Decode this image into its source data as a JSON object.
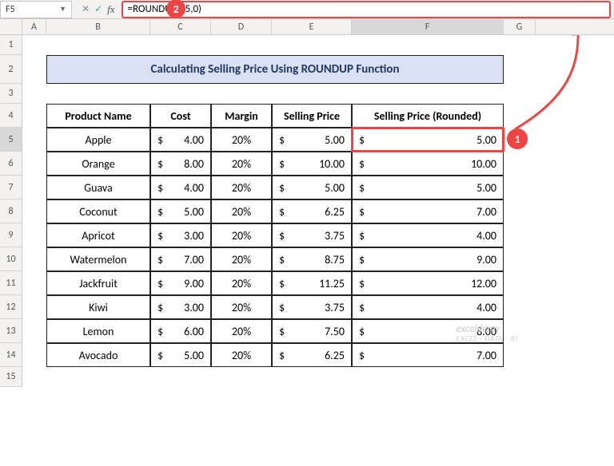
{
  "nameBox": "F5",
  "formula": "=ROUNDUP(E5,0)",
  "callout1": "1",
  "callout2": "2",
  "columns": [
    "A",
    "B",
    "C",
    "D",
    "E",
    "F",
    "G"
  ],
  "rows": [
    "1",
    "2",
    "3",
    "4",
    "5",
    "6",
    "7",
    "8",
    "9",
    "10",
    "11",
    "12",
    "13",
    "14",
    "15"
  ],
  "title": "Calculating Selling Price Using ROUNDUP Function",
  "headers": {
    "product": "Product Name",
    "cost": "Cost",
    "margin": "Margin",
    "selling": "Selling Price",
    "rounded": "Selling Price (Rounded)"
  },
  "currency": "$",
  "data": [
    {
      "product": "Apple",
      "cost": "4.00",
      "margin": "20%",
      "selling": "5.00",
      "rounded": "5.00"
    },
    {
      "product": "Orange",
      "cost": "8.00",
      "margin": "20%",
      "selling": "10.00",
      "rounded": "10.00"
    },
    {
      "product": "Guava",
      "cost": "4.00",
      "margin": "20%",
      "selling": "5.00",
      "rounded": "5.00"
    },
    {
      "product": "Coconut",
      "cost": "5.00",
      "margin": "20%",
      "selling": "6.25",
      "rounded": "7.00"
    },
    {
      "product": "Apricot",
      "cost": "3.00",
      "margin": "20%",
      "selling": "3.75",
      "rounded": "4.00"
    },
    {
      "product": "Watermelon",
      "cost": "7.00",
      "margin": "20%",
      "selling": "8.75",
      "rounded": "9.00"
    },
    {
      "product": "Jackfruit",
      "cost": "9.00",
      "margin": "20%",
      "selling": "11.25",
      "rounded": "12.00"
    },
    {
      "product": "Kiwi",
      "cost": "3.00",
      "margin": "20%",
      "selling": "3.75",
      "rounded": "4.00"
    },
    {
      "product": "Lemon",
      "cost": "6.00",
      "margin": "20%",
      "selling": "7.50",
      "rounded": "8.00"
    },
    {
      "product": "Avocado",
      "cost": "5.00",
      "margin": "20%",
      "selling": "6.25",
      "rounded": "7.00"
    }
  ],
  "watermark": {
    "main": "exceldemy",
    "sub": "EXCEL · DATA · BI"
  }
}
